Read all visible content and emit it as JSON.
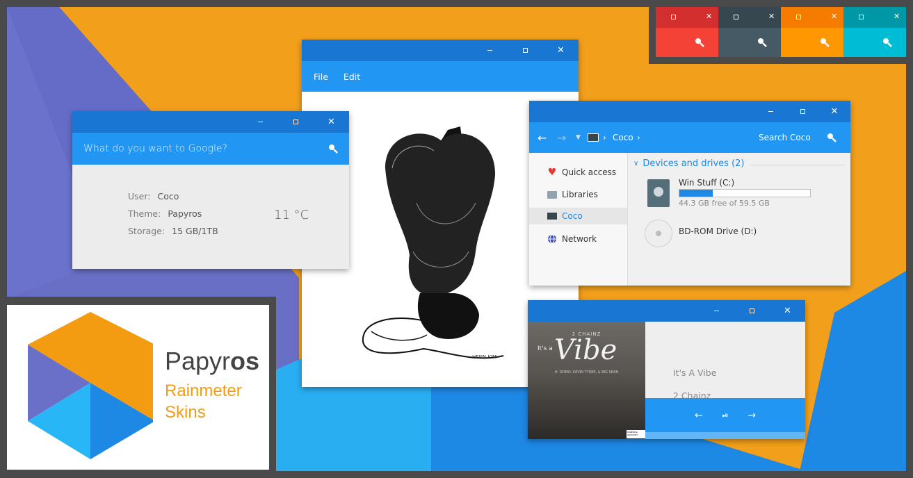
{
  "colors": {
    "primary": "#2196f3",
    "primary_dark": "#1976d2",
    "accent": "#f39c12",
    "indigo": "#6a70c8",
    "light_blue": "#29b6f6"
  },
  "swatches": [
    {
      "name": "red",
      "top": "#d32f2f",
      "bottom": "#f44336"
    },
    {
      "name": "slate",
      "top": "#37474f",
      "bottom": "#455a64"
    },
    {
      "name": "orange",
      "top": "#f57c00",
      "bottom": "#ff9800"
    },
    {
      "name": "cyan",
      "top": "#0097a7",
      "bottom": "#00bcd4"
    }
  ],
  "titlebar": {
    "minimize": "–",
    "maximize": "",
    "close": "✕"
  },
  "google_widget": {
    "placeholder": "What do you want to Google?",
    "user_key": "User:",
    "user_val": "Coco",
    "theme_key": "Theme:",
    "theme_val": "Papyros",
    "storage_key": "Storage:",
    "storage_val": "15 GB/1TB",
    "temperature": "11 °C"
  },
  "drawing_window": {
    "menu": [
      "File",
      "Edit"
    ],
    "signature": "HENN KIM"
  },
  "explorer": {
    "breadcrumb": "Coco",
    "search_placeholder": "Search Coco",
    "sidebar": [
      {
        "label": "Quick access",
        "icon": "heart-icon"
      },
      {
        "label": "Libraries",
        "icon": "folder-icon"
      },
      {
        "label": "Coco",
        "icon": "monitor-icon"
      },
      {
        "label": "Network",
        "icon": "globe-icon"
      }
    ],
    "section_title": "Devices and drives (2)",
    "drives": [
      {
        "name": "Win Stuff (C:)",
        "free": "44.3 GB free of 59.5 GB",
        "used_fraction": 0.255
      },
      {
        "name": "BD-ROM Drive (D:)"
      }
    ]
  },
  "music_player": {
    "track": "It's A Vibe",
    "artist": "2 Chainz",
    "album_art_title": "Vibe",
    "album_art_overline": "2 CHAINZ",
    "album_art_prefix": "It's a",
    "album_art_features": "ft. DOMO, KEVIN TYREE, & BIG SEAN",
    "album_art_label": "PARENTAL ADVISORY",
    "prev": "←",
    "playpause": "⏯",
    "next": "→",
    "progress_fraction": 0.0
  },
  "logo": {
    "brand_light": "Papyr",
    "brand_bold": "os",
    "line1": "Rainmeter",
    "line2": "Skins"
  }
}
